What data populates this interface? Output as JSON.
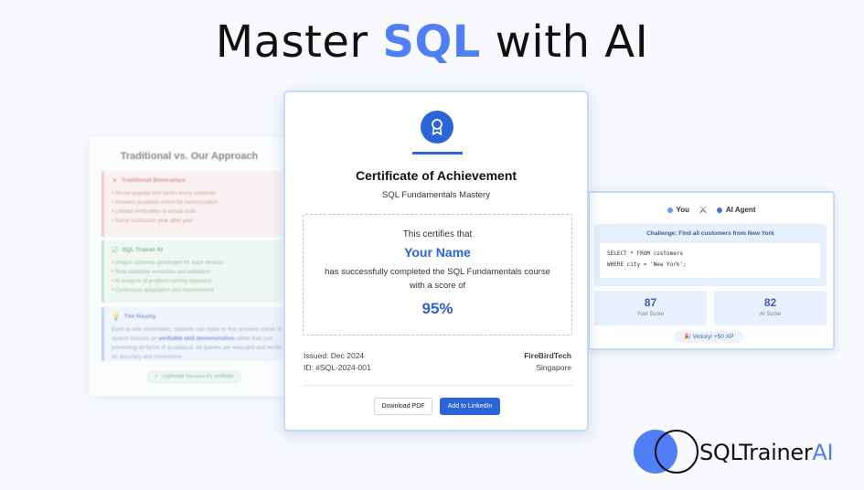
{
  "headline": {
    "prefix": "Master",
    "accent": "SQL",
    "suffix": "with AI"
  },
  "colors": {
    "accent": "#4f7ef5",
    "primary": "#2b63d8"
  },
  "comparison_card": {
    "title": "Traditional vs. Our Approach",
    "traditional": {
      "heading": "Traditional Bootcamps",
      "icon": "x-mark-icon",
      "items": [
        "Reuse popular test banks every semester",
        "Answers available online for memorization",
        "Limited verification of actual skills",
        "Same curriculum year after year"
      ]
    },
    "trainer": {
      "heading": "SQL Trainer AI",
      "icon": "checkbox-icon",
      "items": [
        "Unique schemas generated for each session",
        "Real database execution and validation",
        "AI analysis of problem-solving approach",
        "Continuous adaptation and improvement"
      ]
    },
    "reality": {
      "heading": "The Reality",
      "icon": "lightbulb-icon",
      "text_before": "Even at elite universities, students can cheat or find answers online. O system focuses on ",
      "emphasis": "verifiable skill demonstration",
      "text_after": " rather than just preventing all forms of assistance. All queries are executed and verifie for accuracy and correctness"
    },
    "badge": "Legitimate because it's verifiable"
  },
  "certificate": {
    "title": "Certificate of Achievement",
    "subtitle": "SQL Fundamentals Mastery",
    "certifies": "This certifies that",
    "name": "Your Name",
    "completed": "has successfully completed the SQL Fundamentals course",
    "score_line": "with a score of",
    "score": "95%",
    "issued": "Issued: Dec 2024",
    "id": "ID: #SQL-2024-001",
    "org": "FireBirdTech",
    "location": "Singapore",
    "download_label": "Download PDF",
    "linkedin_label": "Add to LinkedIn"
  },
  "battle_card": {
    "you_label": "You",
    "ai_label": "AI Agent",
    "you_color": "#6b9bf0",
    "ai_color": "#4a6fd6",
    "challenge": "Challenge: Find all customers from New York",
    "code_line1": "SELECT * FROM customers",
    "code_line2": "WHERE city = 'New York';",
    "your_score": "87",
    "your_score_label": "Your Score",
    "ai_score": "82",
    "ai_score_label": "AI Score",
    "victory": "🎉 Victory! +50 XP"
  },
  "logo": {
    "text": "SQLTrainer",
    "accent": "AI"
  }
}
